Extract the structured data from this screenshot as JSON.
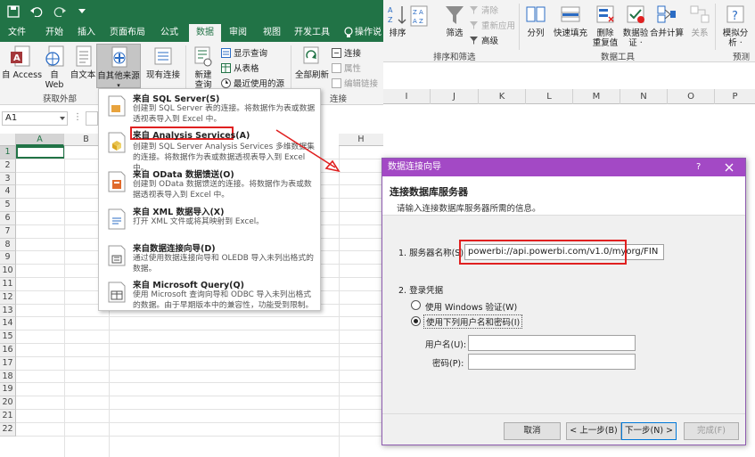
{
  "left_window": {
    "ribbon_tabs": [
      {
        "label": "文件"
      },
      {
        "label": "开始"
      },
      {
        "label": "插入"
      },
      {
        "label": "页面布局"
      },
      {
        "label": "公式"
      },
      {
        "label": "数据"
      },
      {
        "label": "审阅"
      },
      {
        "label": "视图"
      },
      {
        "label": "开发工具"
      },
      {
        "label": "操作说"
      }
    ],
    "ribbon_buttons": {
      "access": "自 Access",
      "web": "自\nWeb",
      "text": "自文本",
      "other": "自其他来源",
      "existing": "现有连接",
      "new_query": "新建\n查询",
      "refresh_all": "全部刷新",
      "show_queries": "显示查询",
      "from_table": "从表格",
      "recent_sources": "最近使用的源",
      "connections": "连接",
      "properties": "属性",
      "edit_links": "编辑链接"
    },
    "groups": {
      "get_external": "获取外部",
      "connections": "连接"
    },
    "name_box": "A1",
    "columns": [
      "A",
      "B",
      "H"
    ],
    "rows": [
      "1",
      "2",
      "3",
      "4",
      "5",
      "6",
      "7",
      "8",
      "9",
      "10",
      "11",
      "12",
      "13",
      "14",
      "15",
      "16",
      "17",
      "18",
      "19",
      "20",
      "21",
      "22"
    ]
  },
  "dropdown": {
    "items": [
      {
        "title": "来自 SQL Server(S)",
        "desc": "创建到 SQL Server 表的连接。将数据作为表或数据透视表导入到 Excel 中。"
      },
      {
        "title": "来自 Analysis Services(A)",
        "desc": "创建到 SQL Server Analysis Services 多维数据集的连接。将数据作为表或数据透视表导入到 Excel 中。"
      },
      {
        "title": "来自 OData 数据馈送(O)",
        "desc": "创建到 OData 数据馈送的连接。将数据作为表或数据透视表导入到 Excel 中。"
      },
      {
        "title": "来自 XML 数据导入(X)",
        "desc": "打开 XML 文件或将其映射到 Excel。"
      },
      {
        "title": "来自数据连接向导(D)",
        "desc": "通过使用数据连接向导和 OLEDB 导入未列出格式的数据。"
      },
      {
        "title": "来自 Microsoft Query(Q)",
        "desc": "使用 Microsoft 查询向导和 ODBC 导入未列出格式的数据。由于早期版本中的兼容性，功能受到限制。"
      }
    ]
  },
  "right_window": {
    "ribbon_buttons": {
      "sort": "排序",
      "filter": "筛选",
      "clear": "清除",
      "reapply": "重新应用",
      "advanced": "高级",
      "split": "分列",
      "flash_fill": "快速填充",
      "remove_dup": "删除\n重复值",
      "validation": "数据验\n证 ·",
      "consolidate": "合并计算",
      "relationships": "关系",
      "whatif": "模拟分\n析 ·",
      "forecast": "预测"
    },
    "groups": {
      "sort_filter": "排序和筛选",
      "data_tools": "数据工具",
      "forecast": "预测"
    },
    "columns": [
      "I",
      "J",
      "K",
      "L",
      "M",
      "N",
      "O",
      "P"
    ]
  },
  "dialog": {
    "title": "数据连接向导",
    "help": "?",
    "heading": "连接数据库服务器",
    "subheading": "请输入连接数据库服务器所需的信息。",
    "server_label": "1. 服务器名称(S):",
    "server_value": "powerbi://api.powerbi.com/v1.0/myorg/FIN",
    "credentials_label": "2. 登录凭据",
    "windows_auth": "使用 Windows 验证(W)",
    "user_pass": "使用下列用户名和密码(I)",
    "username_label": "用户名(U):",
    "password_label": "密码(P):",
    "username_value": "",
    "password_value": "",
    "buttons": {
      "cancel": "取消",
      "back": "< 上一步(B)",
      "next": "下一步(N) >",
      "finish": "完成(F)"
    }
  },
  "colors": {
    "excel_green": "#217346",
    "dialog_purple": "#a349c5",
    "highlight_red": "#e02020"
  }
}
